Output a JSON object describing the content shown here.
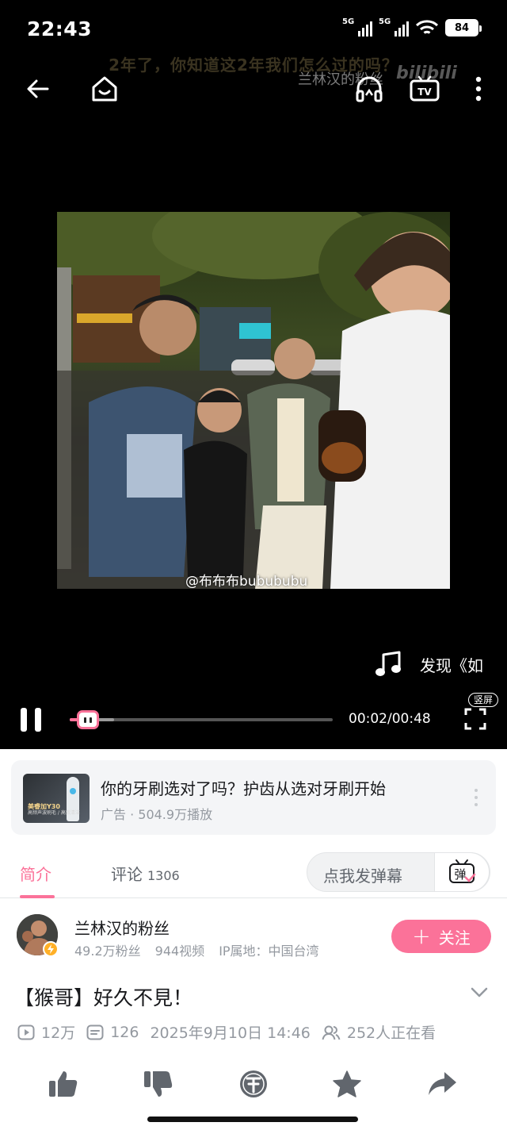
{
  "status_bar": {
    "time": "22:43",
    "signal1_label": "5G",
    "signal2_label": "5G",
    "battery": "84"
  },
  "player": {
    "overlay_caption": "2年了，你知道这2年我们怎么过的吗？",
    "overlay_fan_label": "兰林汉的粉丝",
    "watermark": "bilibili",
    "photo_credit": "@布布布bubububu",
    "music_text": "发现《如",
    "current_time": "00:02",
    "duration": "00:48",
    "time_label": "00:02/00:48",
    "progress_fraction": 0.05,
    "buffer_fraction": 0.17,
    "vertical_badge": "竖屏"
  },
  "ad": {
    "title": "你的牙刷选对了吗？护齿从选对牙刷开始",
    "meta": "广告 · 504.9万播放",
    "thumb_brand": "美睿加Y30",
    "thumb_tagline": "高频声波刷毛 / 高效清洁"
  },
  "tabs": {
    "intro_label": "简介",
    "comments_label": "评论",
    "comments_count": "1306",
    "danmaku_placeholder": "点我发弹幕",
    "danmaku_switch_label": "弹"
  },
  "uploader": {
    "name": "兰林汉的粉丝",
    "fans": "49.2万粉丝",
    "videos": "944视频",
    "ip": "IP属地：中国台湾",
    "follow_label": "关注"
  },
  "video": {
    "title": "【猴哥】好久不見！",
    "views": "12万",
    "danmaku_count": "126",
    "date": "2025年9月10日 14:46",
    "watching": "252人正在看"
  },
  "colors": {
    "brand_pink": "#fb7299",
    "text_primary": "#18191c",
    "text_secondary": "#9499a0"
  },
  "icons": {
    "back": "arrow-left-icon",
    "home": "home-smile-icon",
    "audio": "headphones-icon",
    "cast": "tv-cast-icon",
    "more": "more-vertical-icon",
    "music": "music-note-icon",
    "fullscreen": "fullscreen-icon",
    "like": "thumbs-up-icon",
    "dislike": "thumbs-down-icon",
    "coin": "coin-icon",
    "favorite": "star-icon",
    "share": "share-icon"
  }
}
